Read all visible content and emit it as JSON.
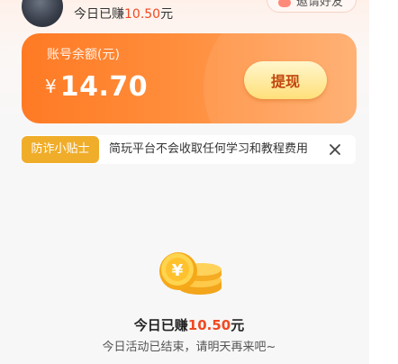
{
  "header": {
    "today_earn_prefix": "今日已赚",
    "today_earn_amount": "10.50",
    "today_earn_suffix": "元",
    "invite_label": "邀请好友"
  },
  "balance_card": {
    "label": "账号余额(元)",
    "currency_symbol": "¥",
    "amount": "14.70",
    "withdraw_label": "提现"
  },
  "tip": {
    "tag": "防诈小贴士",
    "text": "简玩平台不会收取任何学习和教程费用"
  },
  "empty_state": {
    "today_earn_prefix": "今日已赚",
    "today_earn_amount": "10.50",
    "today_earn_suffix": "元",
    "ended_message": "今日活动已结束，请明天再来吧~"
  },
  "colors": {
    "accent_orange": "#ff7a24",
    "earn_red": "#ef4a22",
    "tip_tag": "#f0ad2a",
    "withdraw_button": "#ffe07a"
  },
  "icons": [
    "avatar",
    "close-icon",
    "coin-stack-icon"
  ]
}
